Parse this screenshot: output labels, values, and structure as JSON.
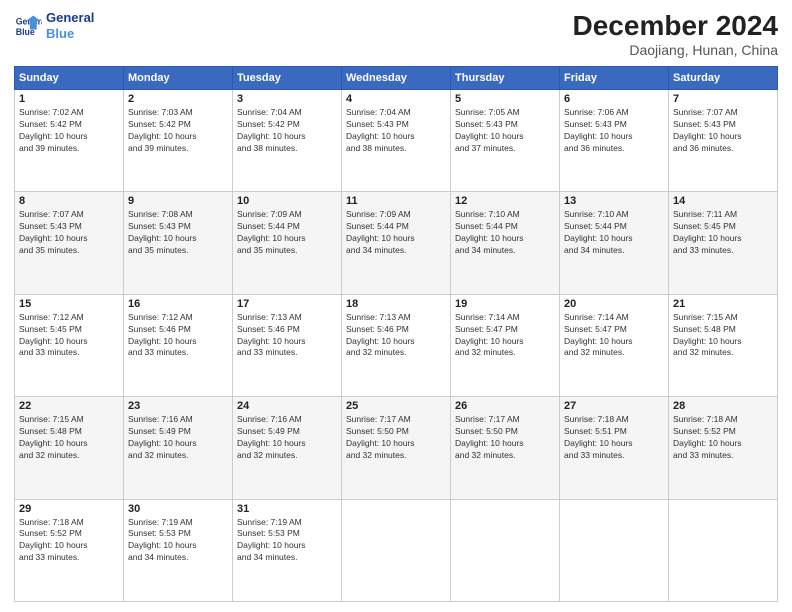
{
  "header": {
    "logo_line1": "General",
    "logo_line2": "Blue",
    "month": "December 2024",
    "location": "Daojiang, Hunan, China"
  },
  "weekdays": [
    "Sunday",
    "Monday",
    "Tuesday",
    "Wednesday",
    "Thursday",
    "Friday",
    "Saturday"
  ],
  "weeks": [
    [
      {
        "day": "1",
        "info": "Sunrise: 7:02 AM\nSunset: 5:42 PM\nDaylight: 10 hours\nand 39 minutes."
      },
      {
        "day": "2",
        "info": "Sunrise: 7:03 AM\nSunset: 5:42 PM\nDaylight: 10 hours\nand 39 minutes."
      },
      {
        "day": "3",
        "info": "Sunrise: 7:04 AM\nSunset: 5:42 PM\nDaylight: 10 hours\nand 38 minutes."
      },
      {
        "day": "4",
        "info": "Sunrise: 7:04 AM\nSunset: 5:43 PM\nDaylight: 10 hours\nand 38 minutes."
      },
      {
        "day": "5",
        "info": "Sunrise: 7:05 AM\nSunset: 5:43 PM\nDaylight: 10 hours\nand 37 minutes."
      },
      {
        "day": "6",
        "info": "Sunrise: 7:06 AM\nSunset: 5:43 PM\nDaylight: 10 hours\nand 36 minutes."
      },
      {
        "day": "7",
        "info": "Sunrise: 7:07 AM\nSunset: 5:43 PM\nDaylight: 10 hours\nand 36 minutes."
      }
    ],
    [
      {
        "day": "8",
        "info": "Sunrise: 7:07 AM\nSunset: 5:43 PM\nDaylight: 10 hours\nand 35 minutes."
      },
      {
        "day": "9",
        "info": "Sunrise: 7:08 AM\nSunset: 5:43 PM\nDaylight: 10 hours\nand 35 minutes."
      },
      {
        "day": "10",
        "info": "Sunrise: 7:09 AM\nSunset: 5:44 PM\nDaylight: 10 hours\nand 35 minutes."
      },
      {
        "day": "11",
        "info": "Sunrise: 7:09 AM\nSunset: 5:44 PM\nDaylight: 10 hours\nand 34 minutes."
      },
      {
        "day": "12",
        "info": "Sunrise: 7:10 AM\nSunset: 5:44 PM\nDaylight: 10 hours\nand 34 minutes."
      },
      {
        "day": "13",
        "info": "Sunrise: 7:10 AM\nSunset: 5:44 PM\nDaylight: 10 hours\nand 34 minutes."
      },
      {
        "day": "14",
        "info": "Sunrise: 7:11 AM\nSunset: 5:45 PM\nDaylight: 10 hours\nand 33 minutes."
      }
    ],
    [
      {
        "day": "15",
        "info": "Sunrise: 7:12 AM\nSunset: 5:45 PM\nDaylight: 10 hours\nand 33 minutes."
      },
      {
        "day": "16",
        "info": "Sunrise: 7:12 AM\nSunset: 5:46 PM\nDaylight: 10 hours\nand 33 minutes."
      },
      {
        "day": "17",
        "info": "Sunrise: 7:13 AM\nSunset: 5:46 PM\nDaylight: 10 hours\nand 33 minutes."
      },
      {
        "day": "18",
        "info": "Sunrise: 7:13 AM\nSunset: 5:46 PM\nDaylight: 10 hours\nand 32 minutes."
      },
      {
        "day": "19",
        "info": "Sunrise: 7:14 AM\nSunset: 5:47 PM\nDaylight: 10 hours\nand 32 minutes."
      },
      {
        "day": "20",
        "info": "Sunrise: 7:14 AM\nSunset: 5:47 PM\nDaylight: 10 hours\nand 32 minutes."
      },
      {
        "day": "21",
        "info": "Sunrise: 7:15 AM\nSunset: 5:48 PM\nDaylight: 10 hours\nand 32 minutes."
      }
    ],
    [
      {
        "day": "22",
        "info": "Sunrise: 7:15 AM\nSunset: 5:48 PM\nDaylight: 10 hours\nand 32 minutes."
      },
      {
        "day": "23",
        "info": "Sunrise: 7:16 AM\nSunset: 5:49 PM\nDaylight: 10 hours\nand 32 minutes."
      },
      {
        "day": "24",
        "info": "Sunrise: 7:16 AM\nSunset: 5:49 PM\nDaylight: 10 hours\nand 32 minutes."
      },
      {
        "day": "25",
        "info": "Sunrise: 7:17 AM\nSunset: 5:50 PM\nDaylight: 10 hours\nand 32 minutes."
      },
      {
        "day": "26",
        "info": "Sunrise: 7:17 AM\nSunset: 5:50 PM\nDaylight: 10 hours\nand 32 minutes."
      },
      {
        "day": "27",
        "info": "Sunrise: 7:18 AM\nSunset: 5:51 PM\nDaylight: 10 hours\nand 33 minutes."
      },
      {
        "day": "28",
        "info": "Sunrise: 7:18 AM\nSunset: 5:52 PM\nDaylight: 10 hours\nand 33 minutes."
      }
    ],
    [
      {
        "day": "29",
        "info": "Sunrise: 7:18 AM\nSunset: 5:52 PM\nDaylight: 10 hours\nand 33 minutes."
      },
      {
        "day": "30",
        "info": "Sunrise: 7:19 AM\nSunset: 5:53 PM\nDaylight: 10 hours\nand 34 minutes."
      },
      {
        "day": "31",
        "info": "Sunrise: 7:19 AM\nSunset: 5:53 PM\nDaylight: 10 hours\nand 34 minutes."
      },
      null,
      null,
      null,
      null
    ]
  ]
}
